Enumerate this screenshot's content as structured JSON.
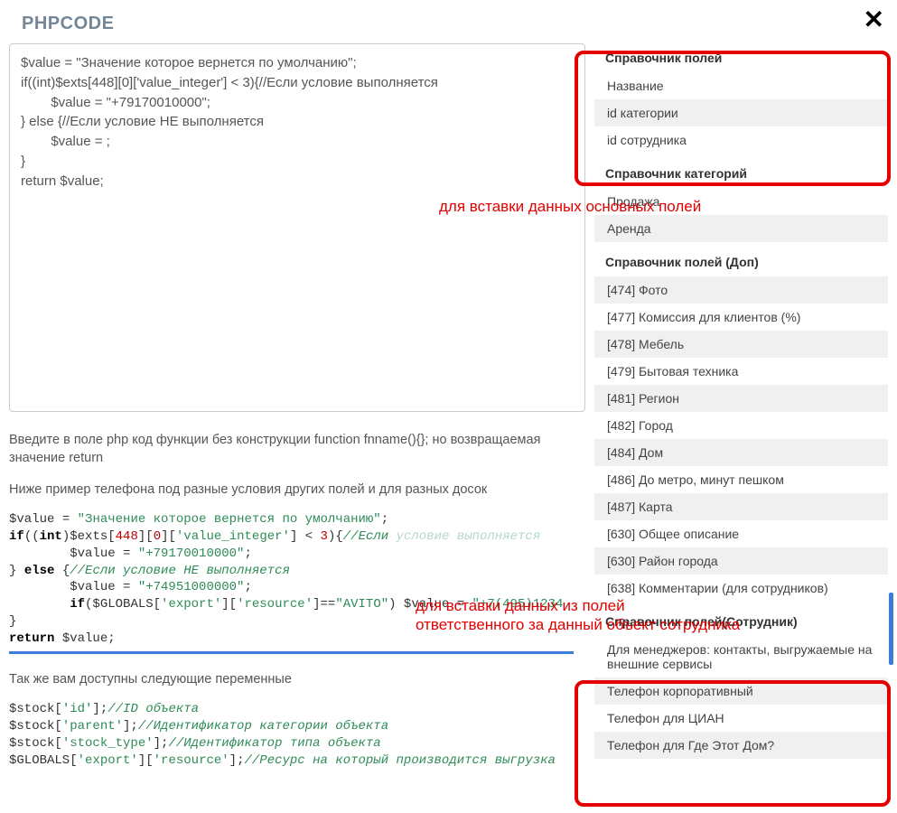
{
  "modal": {
    "title": "PHPCODE",
    "close": "✕"
  },
  "editor": {
    "value": "$value = \"Значение которое вернется по умолчанию\";\nif((int)$exts[448][0]['value_integer'] < 3){//Если условие выполняется\n        $value = \"+79170010000\";\n} else {//Если условие НЕ выполняется\n        $value = ;\n}\nreturn $value;"
  },
  "help": {
    "intro": "Введите в поле php код функции без конструкции function fnname(){}; но возвращаемая значение return",
    "example_hint": "Ниже пример телефона под разные условия других полей и для разных досок",
    "vars_hint": "Так же вам доступны следующие переменные"
  },
  "code1": {
    "l1a": "$value",
    "l1b": " = ",
    "l1c": "\"Значение которое вернется по умолчанию\"",
    "l1d": ";",
    "l2a": "if",
    "l2b": "((",
    "l2c": "int",
    "l2d": ")$exts[",
    "l2e": "448",
    "l2f": "][",
    "l2g": "0",
    "l2h": "][",
    "l2i": "'value_integer'",
    "l2j": "] < ",
    "l2k": "3",
    "l2l": "){",
    "l2m": "//Если",
    "l2n": " условие выполняется",
    "l3a": "        $value = ",
    "l3b": "\"+79170010000\"",
    "l3c": ";",
    "l4a": "} ",
    "l4b": "else",
    "l4c": " {",
    "l4d": "//Если условие НЕ выполняется",
    "l5a": "        $value = ",
    "l5b": "\"+74951000000\"",
    "l5c": ";",
    "l6a": "        ",
    "l6b": "if",
    "l6c": "($GLOBALS[",
    "l6d": "'export'",
    "l6e": "][",
    "l6f": "'resource'",
    "l6g": "]==",
    "l6h": "\"AVITO\"",
    "l6i": ") $value = ",
    "l6j": "\"+7(495)1234",
    "l7a": "}",
    "l8a": "return",
    "l8b": " $value;"
  },
  "code2": {
    "l1a": "$stock[",
    "l1b": "'id'",
    "l1c": "];",
    "l1d": "//ID объекта",
    "l2a": "$stock[",
    "l2b": "'parent'",
    "l2c": "];",
    "l2d": "//Идентификатор категории объекта",
    "l3a": "$stock[",
    "l3b": "'stock_type'",
    "l3c": "];",
    "l3d": "//Идентификатор типа объекта",
    "l4a": "$GLOBALS[",
    "l4b": "'export'",
    "l4c": "][",
    "l4d": "'resource'",
    "l4e": "];",
    "l4f": "//Ресурс на который производится выгрузка"
  },
  "ref": {
    "fields_title": "Справочник полей",
    "fields": [
      "Название",
      "id категории",
      "id сотрудника"
    ],
    "cat_title": "Справочник категорий",
    "cats": [
      "Продажа",
      "Аренда"
    ],
    "extra_title": "Справочник полей (Доп)",
    "extras": [
      "[474] Фото",
      "[477] Комиссия для клиентов (%)",
      "[478] Мебель",
      "[479] Бытовая техника",
      "[481] Регион",
      "[482] Город",
      "[484] Дом",
      "[486] До метро, минут пешком",
      "[487] Карта",
      "[630] Общее описание",
      "[630] Район города",
      "[638] Комментарии (для сотрудников)"
    ],
    "staff_title": "Справочник полей(Сотрудник)",
    "staff": [
      "Для менеджеров: контакты, выгружаемые на внешние сервисы",
      "Телефон корпоративный",
      "Телефон для ЦИАН",
      "Телефон для Где Этот Дом?"
    ]
  },
  "annotations": {
    "label1": "для вставки данных основных полей",
    "label2_line1": "для вставки данных из полей",
    "label2_line2": "ответственного за данный объект сотрудника"
  }
}
